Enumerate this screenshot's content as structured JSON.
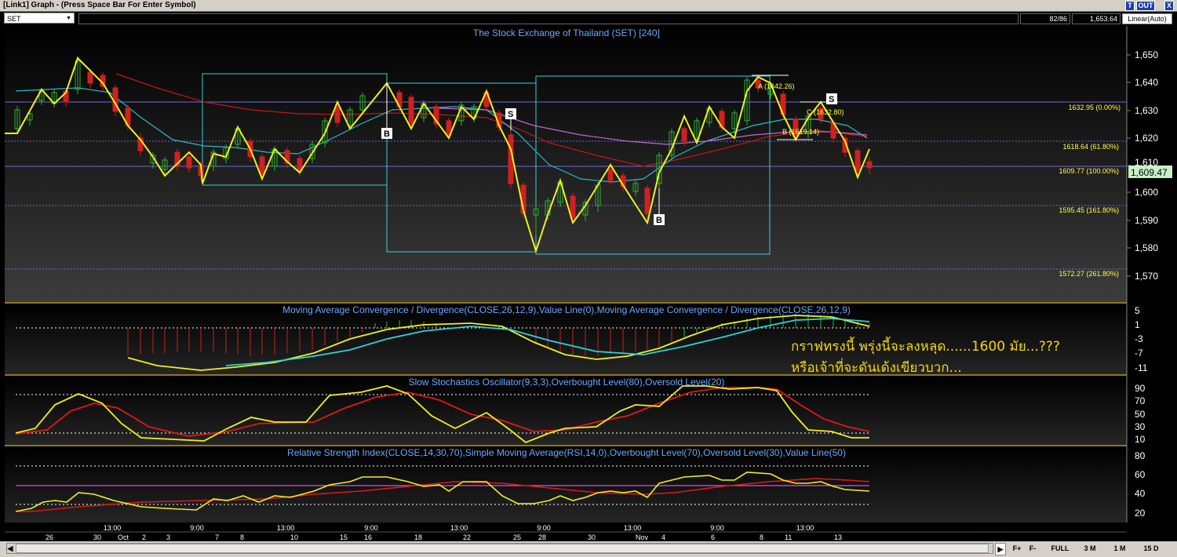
{
  "window": {
    "title": "[Link1] Graph - (Press Space Bar For Enter Symbol)",
    "buttons": [
      "T",
      "OUT",
      "X"
    ]
  },
  "toolbar": {
    "symbol": "SET",
    "bar_count": "82/86",
    "last_value": "1,653.64",
    "scale_mode": "Linear(Auto)"
  },
  "main_panel": {
    "title": "The Stock Exchange of Thailand (SET) [240]",
    "price_ticks": [
      "1,650",
      "1,640",
      "1,630",
      "1,620",
      "1,610",
      "1,600",
      "1,590",
      "1,580",
      "1,570"
    ],
    "current_price": "1,609.47",
    "fib_labels": [
      "1632.95 (0.00%)",
      "1618.64 (61.80%)",
      "1609.77 (100.00%)",
      "1595.45 (161.80%)",
      "1572.27 (261.80%)"
    ],
    "point_labels": [
      "A (1642.26)",
      "C (1632.80)",
      "B (1619.14)"
    ],
    "signals": [
      "B",
      "S",
      "B",
      "S"
    ]
  },
  "macd_panel": {
    "title": "Moving Average Convergence / Divergence(CLOSE,26,12,9),Value Line(0),Moving Average Convergence / Divergence(CLOSE,26,12,9)",
    "ticks": [
      "5",
      "1",
      "-3",
      "-7",
      "-11"
    ],
    "note_line1": "กราฟทรงนี้ พรุ่งนี้จะลงหลุด......1600 มัย...???",
    "note_line2": "หรือเจ้าที่จะดันเด้งเขียวบวก..."
  },
  "stoch_panel": {
    "title": "Slow Stochastics Oscillator(9,3,3),Overbought Level(80),Oversold Level(20)",
    "ticks": [
      "90",
      "70",
      "50",
      "30",
      "10"
    ]
  },
  "rsi_panel": {
    "title": "Relative Strength Index(CLOSE,14,30,70),Simple Moving Average(RSI,14,0),Overbought Level(70),Oversold Level(30),Value Line(50)",
    "ticks": [
      "80",
      "60",
      "40",
      "20"
    ]
  },
  "time_axis": {
    "top_labels": [
      "13:00",
      "9:00",
      "13:00",
      "9:00",
      "13:00",
      "9:00",
      "13:00",
      "9:00",
      "13:00"
    ],
    "bottom_labels": [
      "26",
      "30",
      "Oct",
      "2",
      "3",
      "7",
      "8",
      "10",
      "15",
      "16",
      "18",
      "22",
      "25",
      "28",
      "30",
      "Nov",
      "4",
      "6",
      "8",
      "11",
      "13"
    ]
  },
  "bottom_bar": {
    "buttons": [
      "F+",
      "F-",
      "FULL",
      "3 M",
      "1 M",
      "15 D"
    ]
  },
  "colors": {
    "zigzag": "#f0f020",
    "bull": "#2db32d",
    "bear": "#d02020",
    "box": "#3ccfd6",
    "fib_text": "#ffff40",
    "panel_title": "#6aa8ff",
    "ma_red": "#c01818",
    "ma_cyan": "#30b8c0",
    "ma_pink": "#c06ad0"
  }
}
